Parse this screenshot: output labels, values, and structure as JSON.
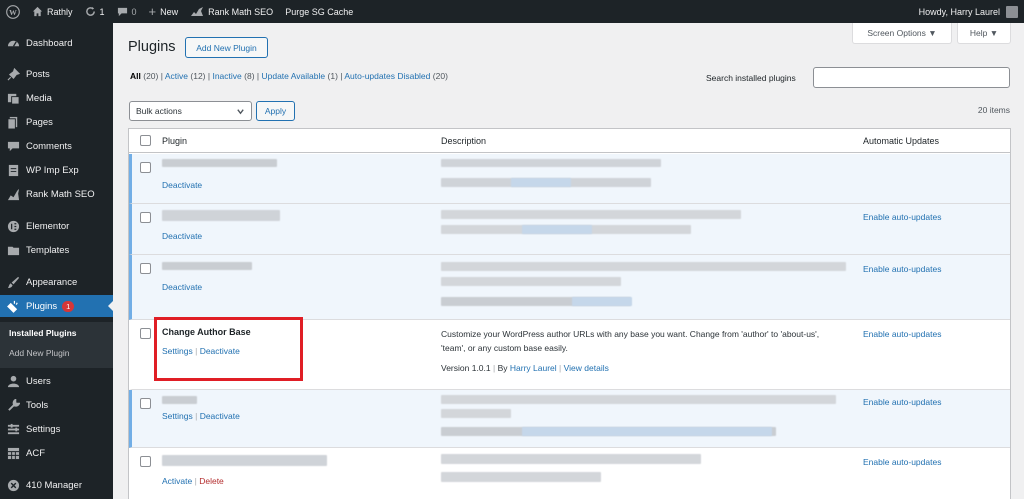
{
  "adminbar": {
    "site_name": "Rathly",
    "updates_count": "1",
    "comments_count": "0",
    "new_label": "New",
    "rankmath_label": "Rank Math SEO",
    "purge_label": "Purge SG Cache",
    "howdy": "Howdy, Harry Laurel"
  },
  "sidebar": {
    "items": [
      {
        "label": "Dashboard",
        "icon": "dashboard-icon"
      },
      {
        "label": "Posts",
        "icon": "pin-icon"
      },
      {
        "label": "Media",
        "icon": "media-icon"
      },
      {
        "label": "Pages",
        "icon": "pages-icon"
      },
      {
        "label": "Comments",
        "icon": "comment-icon"
      },
      {
        "label": "WP Imp Exp",
        "icon": "wordpress-icon"
      },
      {
        "label": "Rank Math SEO",
        "icon": "chart-icon"
      },
      {
        "label": "Elementor",
        "icon": "elementor-icon"
      },
      {
        "label": "Templates",
        "icon": "folder-icon"
      },
      {
        "label": "Appearance",
        "icon": "brush-icon"
      },
      {
        "label": "Plugins",
        "icon": "plugin-icon",
        "badge": "1"
      },
      {
        "label": "Users",
        "icon": "users-icon"
      },
      {
        "label": "Tools",
        "icon": "wrench-icon"
      },
      {
        "label": "Settings",
        "icon": "settings-icon"
      },
      {
        "label": "ACF",
        "icon": "grid-icon"
      },
      {
        "label": "410 Manager",
        "icon": "x-circle-icon"
      }
    ],
    "submenu": {
      "installed": "Installed Plugins",
      "add_new": "Add New Plugin"
    }
  },
  "header": {
    "title": "Plugins",
    "add_new": "Add New Plugin",
    "screen_options": "Screen Options ▼",
    "help": "Help ▼"
  },
  "filters": {
    "all": "All",
    "all_count": "(20)",
    "active": "Active",
    "active_count": "(12)",
    "inactive": "Inactive",
    "inactive_count": "(8)",
    "update": "Update Available",
    "update_count": "(1)",
    "auto_disabled": "Auto-updates Disabled",
    "auto_disabled_count": "(20)"
  },
  "search": {
    "label": "Search installed plugins",
    "placeholder": ""
  },
  "bulk": {
    "selected": "Bulk actions",
    "apply": "Apply",
    "items_count": "20 items"
  },
  "table": {
    "col_plugin": "Plugin",
    "col_description": "Description",
    "col_auto": "Automatic Updates",
    "deactivate": "Deactivate",
    "settings": "Settings",
    "activate": "Activate",
    "delete": "Delete",
    "enable_auto": "Enable auto-updates",
    "separator": "|",
    "featured": {
      "name": "Change Author Base",
      "description": "Customize your WordPress author URLs with any base you want. Change from 'author' to 'about-us', 'team', or any custom base easily.",
      "version": "Version 1.0.1",
      "by": "By",
      "author": "Harry Laurel",
      "view_details": "View details"
    }
  },
  "colors": {
    "accent": "#2271b1",
    "highlight": "#e01e25",
    "adminbar": "#1d2327"
  }
}
